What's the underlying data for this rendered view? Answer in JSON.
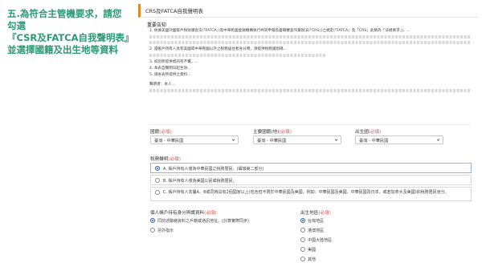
{
  "heading": {
    "line1": "五.為符合主管機要求，請您",
    "line2": "勾選",
    "line3": "『CSR及FATCA自我聲明表』",
    "line4": "並選擇國籍及出生地等資料"
  },
  "form": {
    "tab_title": "CRS及FATCA自我聲明表",
    "notice_heading": "重要告知",
    "notice": [
      "1. 依據美國外國帳戶稅收遵從法(「FATCA」)及中華民國金融機構執行共同申報及盡職審查作業辦法(「CRS」)之規定(「FATCA」及「CRS」此稱為「法規要求」)，…",
      "2. 當帳戶持有人具有美國或中華民國以外之稅務居住者身分時，須提供稅務識別碼…",
      "3. 如您所提供資訊有不實，…",
      "4. 本表自聲明日起生效…",
      "5. 請本表所提供之資料…"
    ],
    "notice_footer": "聲明者：本人…"
  },
  "fields": {
    "nationality": {
      "label": "國籍",
      "required": "(必填)",
      "value": "臺灣 - 中華民國"
    },
    "main_nationality": {
      "label": "主要國籍(地)",
      "required": "(必填)",
      "value": "臺灣 - 中華民國"
    },
    "birthplace": {
      "label": "出生國",
      "required": "(必填)",
      "value": "臺灣 - 中華民國"
    }
  },
  "tax_identity": {
    "label": "稅務聲明",
    "required": "(必填)",
    "options": [
      {
        "text": "A. 帳戶持有人僅為中華民國之稅務居民。(續填第二部分)",
        "selected": true
      },
      {
        "text": "B. 帳戶持有人僅為美國公民或稅務居民。",
        "selected": false
      },
      {
        "text": "C. 帳戶持有人非屬A、B或同時具有2個國家以上(包含但不限於中華民國及美國，例如：中華民國及美國、中華民國及日本，或若加拿大及美國)的稅務居民身分。",
        "selected": false
      }
    ]
  },
  "account_type": {
    "label": "個人帳戶持有身分辨識資料",
    "required": "(必填)",
    "options": [
      {
        "text": "同前述聯絡資料之戶籍或通訊地址。(計算實際同步)",
        "selected": true
      },
      {
        "text": "另外指示",
        "selected": false
      }
    ]
  },
  "birth_region": {
    "label": "出生地區",
    "required": "(必填)",
    "options": [
      {
        "text": "台灣地區",
        "selected": true
      },
      {
        "text": "港澳地區",
        "selected": false
      },
      {
        "text": "中國大陸地區",
        "selected": false
      },
      {
        "text": "美國",
        "selected": false
      },
      {
        "text": "其他",
        "selected": false
      }
    ]
  },
  "colors": {
    "accent": "#e08a2e",
    "heading": "#2a9a74",
    "required": "#d9534f",
    "radio": "#1f5fbf"
  }
}
